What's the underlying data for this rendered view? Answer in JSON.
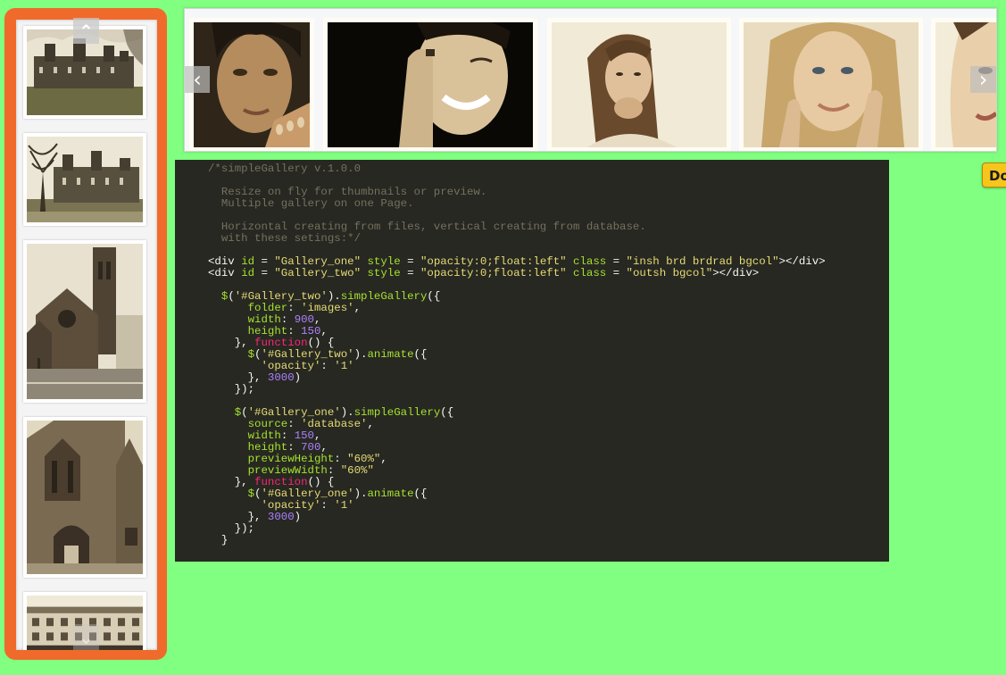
{
  "gallery_one": {
    "thumbnails": [
      {
        "subject": "castle-lawn-photo"
      },
      {
        "subject": "castle-trees-photo"
      },
      {
        "subject": "church-tower-photo"
      },
      {
        "subject": "stone-church-photo"
      },
      {
        "subject": "hotel-building-photo"
      }
    ],
    "nav_up_icon": "chevron-up-icon",
    "nav_down_icon": "chevron-down-icon"
  },
  "gallery_two": {
    "thumbnails": [
      {
        "subject": "portrait-1"
      },
      {
        "subject": "portrait-2"
      },
      {
        "subject": "portrait-3"
      },
      {
        "subject": "portrait-4"
      },
      {
        "subject": "portrait-5"
      }
    ],
    "prev_icon": "chevron-left-icon",
    "next_icon": "chevron-right-icon"
  },
  "code": {
    "lines": [
      "/*simpleGallery v.1.0.0",
      "",
      "  Resize on fly for thumbnails or preview.",
      "  Multiple gallery on one Page.",
      "",
      "  Horizontal creating from files, vertical creating from database.",
      "  with these setings:*/",
      "",
      "<div id = \"Gallery_one\" style = \"opacity:0;float:left\" class = \"insh brd brdrad bgcol\"></div>",
      "<div id = \"Gallery_two\" style = \"opacity:0;float:left\" class = \"outsh bgcol\"></div>",
      "",
      "  $('#Gallery_two').simpleGallery({",
      "      folder: 'images',",
      "      width: 900,",
      "      height: 150,",
      "    }, function() {",
      "      $('#Gallery_two').animate({",
      "        'opacity': '1'",
      "      }, 3000)",
      "    });",
      "",
      "    $('#Gallery_one').simpleGallery({",
      "      source: 'database',",
      "      width: 150,",
      "      height: 700,",
      "      previewHeight: \"60%\",",
      "      previewWidth: \"60%\"",
      "    }, function() {",
      "      $('#Gallery_one').animate({",
      "        'opacity': '1'",
      "      }, 3000)",
      "    });",
      "  }"
    ]
  },
  "docs_badge": {
    "label": "Do"
  },
  "colors": {
    "background": "#80ff80",
    "gallery_border": "#f06a2c",
    "code_background": "#272822",
    "badge": "#f8c51c"
  }
}
